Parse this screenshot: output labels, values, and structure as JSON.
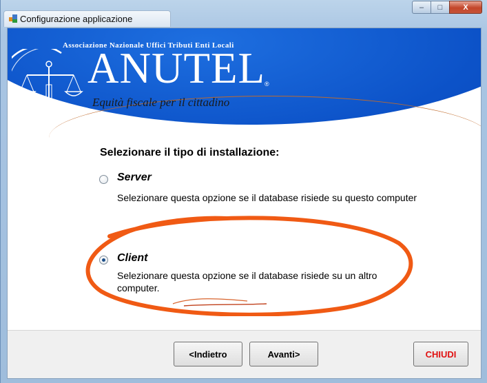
{
  "window": {
    "title": "Configurazione applicazione",
    "minimize_symbol": "–",
    "maximize_symbol": "□",
    "close_symbol": "X"
  },
  "banner": {
    "association": "Associazione Nazionale Uffici Tributi Enti Locali",
    "logo": "ANUTEL",
    "registered_mark": "®",
    "slogan": "Equità fiscale per il cittadino",
    "colors": {
      "blue": "#0c52c8",
      "arc": "#c06b2c"
    },
    "emblem_icon": "scales-of-justice-icon"
  },
  "installation": {
    "heading": "Selezionare il tipo di installazione:",
    "options": [
      {
        "label": "Server",
        "description": "Selezionare questa opzione se il database risiede su questo computer",
        "checked": false
      },
      {
        "label": "Client",
        "description": "Selezionare questa opzione se il database risiede su un altro computer.",
        "checked": true
      }
    ],
    "highlight_color": "#f05a14"
  },
  "footer": {
    "back_label": "<Indietro",
    "next_label": "Avanti>",
    "close_label": "CHIUDI"
  }
}
